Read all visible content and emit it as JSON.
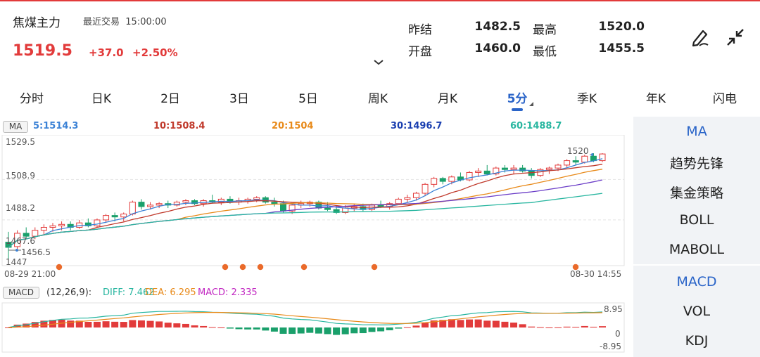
{
  "header": {
    "name": "焦煤主力",
    "status_label": "最近交易",
    "time": "15:00:00",
    "price": "1519.5",
    "change": "+37.0",
    "change_pct": "+2.50%"
  },
  "stats": {
    "prev_settle_label": "昨结",
    "prev_settle": "1482.5",
    "high_label": "最高",
    "high": "1520.0",
    "open_label": "开盘",
    "open": "1460.0",
    "low_label": "最低",
    "low": "1455.5"
  },
  "tools": {
    "draw_icon": "pen-draw-icon",
    "collapse_icon": "collapse-arrows-icon"
  },
  "tabs": [
    "分时",
    "日K",
    "2日",
    "3日",
    "5日",
    "周K",
    "月K",
    "5分",
    "季K",
    "年K",
    "闪电"
  ],
  "active_tab": "5分",
  "ma_bar": {
    "chip": "MA",
    "ma5": "5:1514.3",
    "ma10": "10:1508.4",
    "ma20": "20:1504",
    "ma30": "30:1496.7",
    "ma60": "60:1488.7"
  },
  "colors": {
    "up": "#e23b3b",
    "down": "#1aa06b",
    "ma5": "#3b82d6",
    "ma10": "#c0392b",
    "ma20": "#e88a1a",
    "ma30": "#6a3cc7",
    "ma60": "#28b6a0",
    "accent": "#2a64c8"
  },
  "price_axis": {
    "top": "1529.5",
    "mid1": "1508.9",
    "mid2": "1488.2",
    "low_mid": "1467.6",
    "bottom": "1447",
    "max_label": "1520",
    "min_label": "1456.5"
  },
  "time_axis": {
    "start": "08-29 21:00",
    "end": "08-30 14:55"
  },
  "macd": {
    "chip": "MACD",
    "params": "(12,26,9):",
    "diff": "DIFF: 7.462",
    "dea": "DEA: 6.295",
    "macd": "MACD: 2.335",
    "axis_top": "8.95",
    "axis_zero": "0",
    "axis_bottom": "-8.95"
  },
  "side_panel": {
    "indicators_top": [
      "MA",
      "趋势先锋",
      "集金策略",
      "BOLL",
      "MABOLL"
    ],
    "indicators_bottom": [
      "MACD",
      "VOL",
      "KDJ"
    ],
    "active_top": "MA",
    "active_bottom": "MACD"
  },
  "chart_data": {
    "type": "candlestick",
    "ylim": [
      1447,
      1529.5
    ],
    "candles": [
      [
        1460,
        1467,
        1447,
        1456.5
      ],
      [
        1457,
        1468,
        1455.5,
        1466
      ],
      [
        1466,
        1470,
        1462,
        1464
      ],
      [
        1464,
        1470,
        1462,
        1468
      ],
      [
        1468,
        1472,
        1465,
        1470
      ],
      [
        1470,
        1473,
        1467,
        1471
      ],
      [
        1471,
        1474,
        1468,
        1472
      ],
      [
        1472,
        1474,
        1468,
        1470
      ],
      [
        1470,
        1475,
        1469,
        1473
      ],
      [
        1473,
        1476,
        1470,
        1471
      ],
      [
        1471,
        1476,
        1470,
        1475
      ],
      [
        1475,
        1479,
        1473,
        1478
      ],
      [
        1478,
        1480,
        1474,
        1477
      ],
      [
        1477,
        1480,
        1474,
        1479
      ],
      [
        1479,
        1488,
        1478,
        1487
      ],
      [
        1487,
        1489,
        1482,
        1484
      ],
      [
        1484,
        1487,
        1482,
        1485
      ],
      [
        1485,
        1487,
        1483,
        1486
      ],
      [
        1486,
        1488,
        1483,
        1485
      ],
      [
        1485,
        1488,
        1484,
        1487
      ],
      [
        1487,
        1489,
        1485,
        1488
      ],
      [
        1488,
        1489,
        1485,
        1486
      ],
      [
        1486,
        1489,
        1484,
        1488
      ],
      [
        1488,
        1492,
        1486,
        1487
      ],
      [
        1487,
        1490,
        1485,
        1489
      ],
      [
        1489,
        1491,
        1486,
        1487
      ],
      [
        1487,
        1490,
        1485,
        1488
      ],
      [
        1488,
        1490,
        1486,
        1489
      ],
      [
        1489,
        1491,
        1487,
        1490
      ],
      [
        1490,
        1491,
        1486,
        1487
      ],
      [
        1487,
        1490,
        1484,
        1486
      ],
      [
        1486,
        1488,
        1480,
        1481
      ],
      [
        1481,
        1486,
        1479,
        1485
      ],
      [
        1485,
        1488,
        1483,
        1486
      ],
      [
        1486,
        1488,
        1484,
        1487
      ],
      [
        1487,
        1488,
        1482,
        1483
      ],
      [
        1483,
        1487,
        1481,
        1482
      ],
      [
        1482,
        1485,
        1479,
        1480
      ],
      [
        1480,
        1485,
        1479,
        1483
      ],
      [
        1483,
        1486,
        1481,
        1484
      ],
      [
        1484,
        1486,
        1481,
        1482
      ],
      [
        1482,
        1486,
        1481,
        1485
      ],
      [
        1485,
        1488,
        1483,
        1484
      ],
      [
        1484,
        1487,
        1482,
        1486
      ],
      [
        1486,
        1490,
        1485,
        1489
      ],
      [
        1489,
        1492,
        1487,
        1490
      ],
      [
        1490,
        1494,
        1488,
        1493
      ],
      [
        1493,
        1500,
        1491,
        1499
      ],
      [
        1499,
        1504,
        1497,
        1503
      ],
      [
        1503,
        1504,
        1499,
        1501
      ],
      [
        1501,
        1505,
        1499,
        1504
      ],
      [
        1504,
        1507,
        1501,
        1502
      ],
      [
        1502,
        1508,
        1501,
        1507
      ],
      [
        1507,
        1510,
        1504,
        1508
      ],
      [
        1508,
        1512,
        1505,
        1506
      ],
      [
        1506,
        1511,
        1505,
        1510
      ],
      [
        1510,
        1512,
        1507,
        1509
      ],
      [
        1509,
        1512,
        1506,
        1510
      ],
      [
        1510,
        1512,
        1507,
        1508
      ],
      [
        1508,
        1510,
        1503,
        1505
      ],
      [
        1505,
        1510,
        1504,
        1509
      ],
      [
        1509,
        1511,
        1506,
        1510
      ],
      [
        1510,
        1513,
        1508,
        1512
      ],
      [
        1512,
        1516,
        1510,
        1515
      ],
      [
        1515,
        1518,
        1512,
        1514
      ],
      [
        1514,
        1519,
        1513,
        1518
      ],
      [
        1518,
        1520,
        1514,
        1515
      ],
      [
        1515,
        1520,
        1514,
        1519.5
      ]
    ]
  }
}
